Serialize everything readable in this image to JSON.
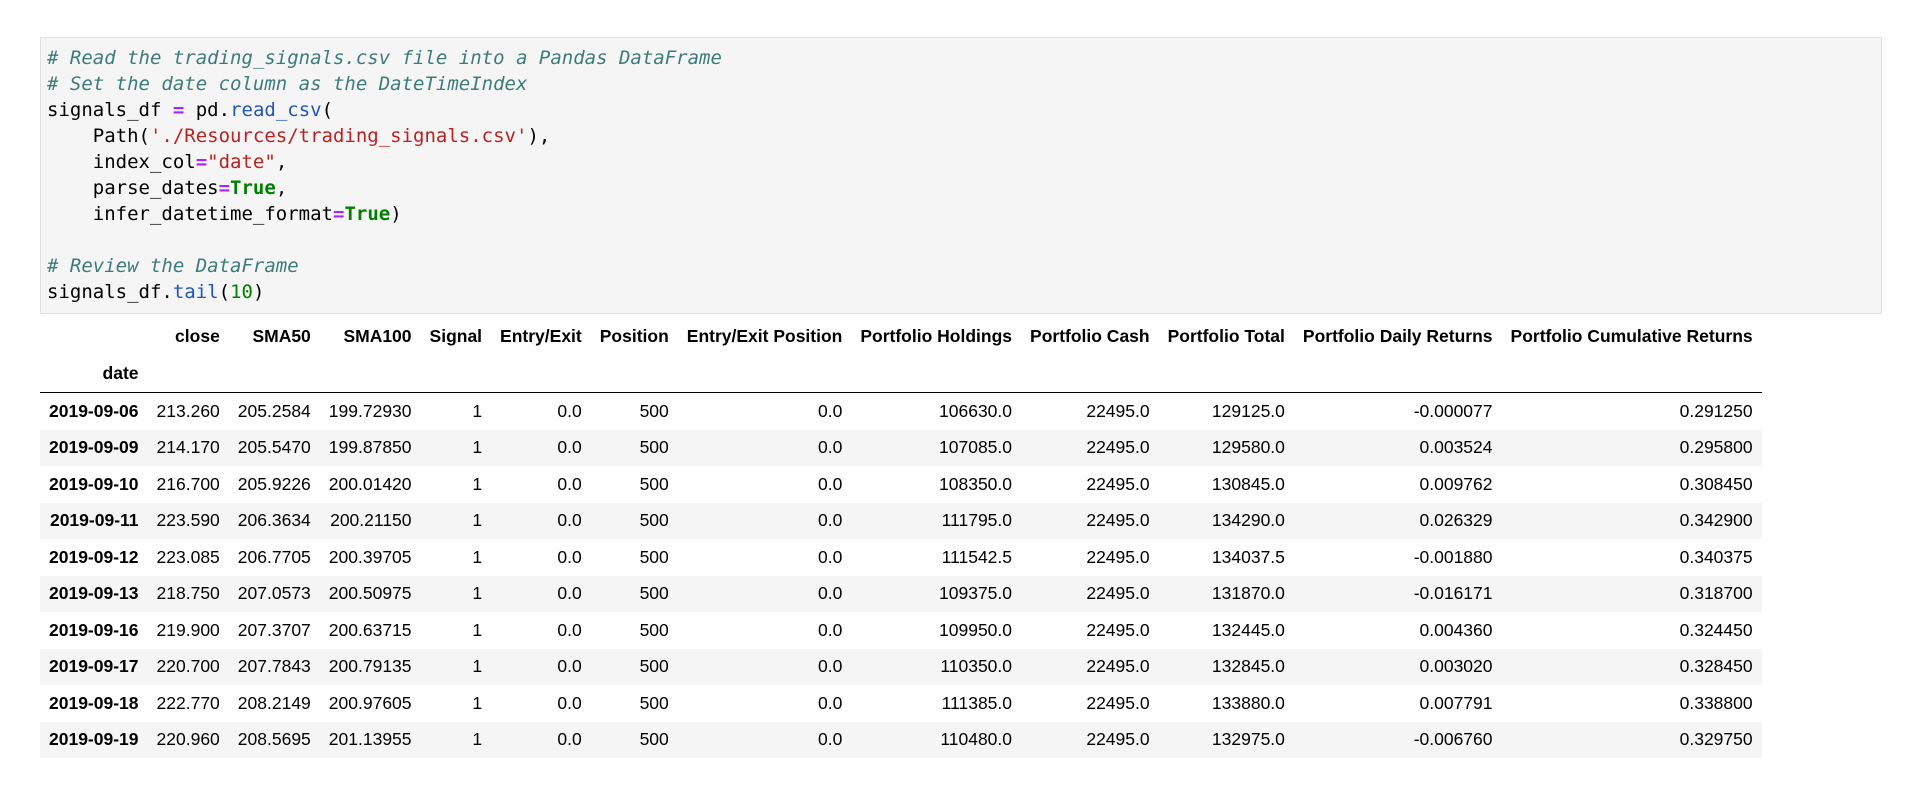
{
  "code_cell": {
    "lines": [
      [
        {
          "t": "# Read the trading_signals.csv file into a Pandas DataFrame",
          "c": "comment"
        }
      ],
      [
        {
          "t": "# Set the date column as the DateTimeIndex",
          "c": "comment"
        }
      ],
      [
        {
          "t": "signals_df ",
          "c": ""
        },
        {
          "t": "=",
          "c": "op"
        },
        {
          "t": " pd.",
          "c": ""
        },
        {
          "t": "read_csv",
          "c": "func"
        },
        {
          "t": "(",
          "c": ""
        }
      ],
      [
        {
          "t": "    Path(",
          "c": ""
        },
        {
          "t": "'./Resources/trading_signals.csv'",
          "c": "str"
        },
        {
          "t": "),",
          "c": ""
        }
      ],
      [
        {
          "t": "    index_col",
          "c": ""
        },
        {
          "t": "=",
          "c": "op"
        },
        {
          "t": "\"date\"",
          "c": "str"
        },
        {
          "t": ",",
          "c": ""
        }
      ],
      [
        {
          "t": "    parse_dates",
          "c": ""
        },
        {
          "t": "=",
          "c": "op"
        },
        {
          "t": "True",
          "c": "kw"
        },
        {
          "t": ",",
          "c": ""
        }
      ],
      [
        {
          "t": "    infer_datetime_format",
          "c": ""
        },
        {
          "t": "=",
          "c": "op"
        },
        {
          "t": "True",
          "c": "kw"
        },
        {
          "t": ")",
          "c": ""
        }
      ],
      [],
      [
        {
          "t": "# Review the DataFrame",
          "c": "comment"
        }
      ],
      [
        {
          "t": "signals_df.",
          "c": ""
        },
        {
          "t": "tail",
          "c": "func"
        },
        {
          "t": "(",
          "c": ""
        },
        {
          "t": "10",
          "c": "num"
        },
        {
          "t": ")",
          "c": ""
        }
      ]
    ]
  },
  "dataframe": {
    "index_name": "date",
    "columns": [
      "close",
      "SMA50",
      "SMA100",
      "Signal",
      "Entry/Exit",
      "Position",
      "Entry/Exit Position",
      "Portfolio Holdings",
      "Portfolio Cash",
      "Portfolio Total",
      "Portfolio Daily Returns",
      "Portfolio Cumulative Returns"
    ],
    "rows": [
      {
        "index": "2019-09-06",
        "values": [
          "213.260",
          "205.2584",
          "199.72930",
          "1",
          "0.0",
          "500",
          "0.0",
          "106630.0",
          "22495.0",
          "129125.0",
          "-0.000077",
          "0.291250"
        ]
      },
      {
        "index": "2019-09-09",
        "values": [
          "214.170",
          "205.5470",
          "199.87850",
          "1",
          "0.0",
          "500",
          "0.0",
          "107085.0",
          "22495.0",
          "129580.0",
          "0.003524",
          "0.295800"
        ]
      },
      {
        "index": "2019-09-10",
        "values": [
          "216.700",
          "205.9226",
          "200.01420",
          "1",
          "0.0",
          "500",
          "0.0",
          "108350.0",
          "22495.0",
          "130845.0",
          "0.009762",
          "0.308450"
        ]
      },
      {
        "index": "2019-09-11",
        "values": [
          "223.590",
          "206.3634",
          "200.21150",
          "1",
          "0.0",
          "500",
          "0.0",
          "111795.0",
          "22495.0",
          "134290.0",
          "0.026329",
          "0.342900"
        ]
      },
      {
        "index": "2019-09-12",
        "values": [
          "223.085",
          "206.7705",
          "200.39705",
          "1",
          "0.0",
          "500",
          "0.0",
          "111542.5",
          "22495.0",
          "134037.5",
          "-0.001880",
          "0.340375"
        ]
      },
      {
        "index": "2019-09-13",
        "values": [
          "218.750",
          "207.0573",
          "200.50975",
          "1",
          "0.0",
          "500",
          "0.0",
          "109375.0",
          "22495.0",
          "131870.0",
          "-0.016171",
          "0.318700"
        ]
      },
      {
        "index": "2019-09-16",
        "values": [
          "219.900",
          "207.3707",
          "200.63715",
          "1",
          "0.0",
          "500",
          "0.0",
          "109950.0",
          "22495.0",
          "132445.0",
          "0.004360",
          "0.324450"
        ]
      },
      {
        "index": "2019-09-17",
        "values": [
          "220.700",
          "207.7843",
          "200.79135",
          "1",
          "0.0",
          "500",
          "0.0",
          "110350.0",
          "22495.0",
          "132845.0",
          "0.003020",
          "0.328450"
        ]
      },
      {
        "index": "2019-09-18",
        "values": [
          "222.770",
          "208.2149",
          "200.97605",
          "1",
          "0.0",
          "500",
          "0.0",
          "111385.0",
          "22495.0",
          "133880.0",
          "0.007791",
          "0.338800"
        ]
      },
      {
        "index": "2019-09-19",
        "values": [
          "220.960",
          "208.5695",
          "201.13955",
          "1",
          "0.0",
          "500",
          "0.0",
          "110480.0",
          "22495.0",
          "132975.0",
          "-0.006760",
          "0.329750"
        ]
      }
    ]
  }
}
